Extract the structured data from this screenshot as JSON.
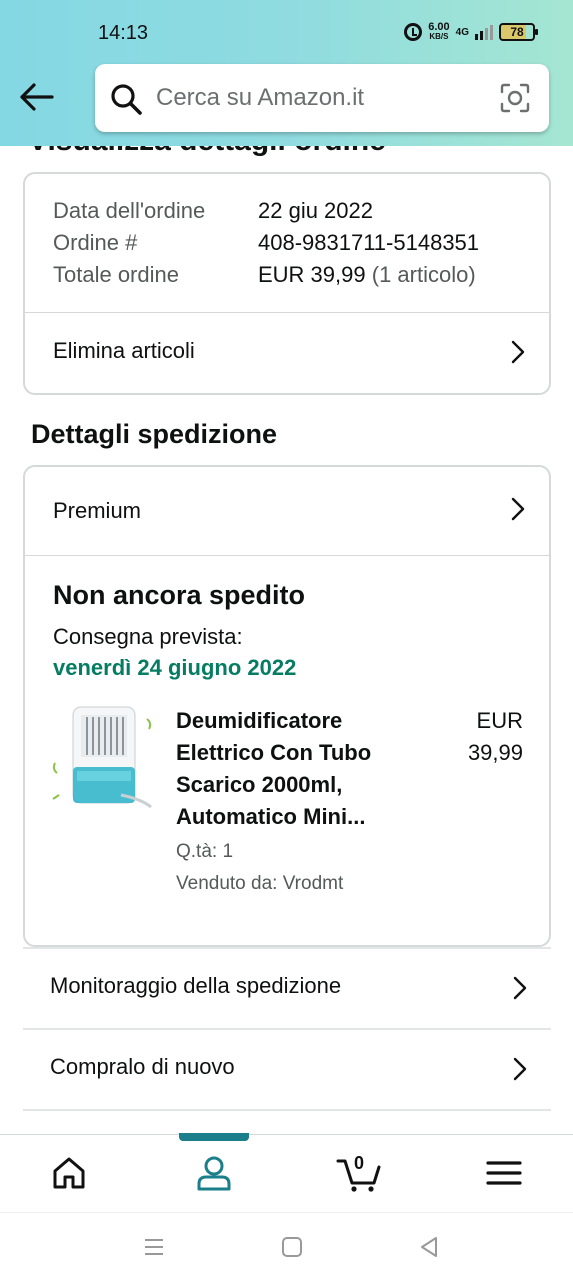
{
  "status_bar": {
    "time": "14:13",
    "speed_value": "6.00",
    "speed_unit": "KB/S",
    "network": "4G",
    "battery": "78",
    "battery_level_percent": 78
  },
  "header": {
    "search_placeholder": "Cerca su Amazon.it",
    "page_title": "Visualizza dettagli ordine"
  },
  "order_summary": {
    "date_label": "Data dell'ordine",
    "date_value": "22 giu 2022",
    "number_label": "Ordine #",
    "number_value": "408-9831711-5148351",
    "total_label": "Totale ordine",
    "total_value": "EUR 39,99",
    "total_items": "(1 articolo)",
    "delete_items_label": "Elimina articoli"
  },
  "shipping": {
    "heading": "Dettagli spedizione",
    "method": "Premium",
    "status": "Non ancora spedito",
    "delivery_label": "Consegna prevista:",
    "delivery_date": "venerdì 24 giugno 2022",
    "item": {
      "title_lines": [
        "Deumidificatore",
        "Elettrico Con Tubo",
        "Scarico 2000ml,",
        "Automatico Mini..."
      ],
      "price_currency": "EUR",
      "price_value": "39,99",
      "quantity": "Q.tà: 1",
      "seller": "Venduto da: Vrodmt"
    }
  },
  "actions": {
    "track_label": "Monitoraggio della spedizione",
    "buy_again_label": "Compralo di nuovo"
  },
  "tab_bar": {
    "cart_count": "0",
    "active_tab": "account"
  },
  "colors": {
    "accent_teal": "#1a7f8a",
    "delivery_green": "#067d62",
    "header_gradient_start": "#84d8e3",
    "header_gradient_end": "#a5e6d2"
  }
}
